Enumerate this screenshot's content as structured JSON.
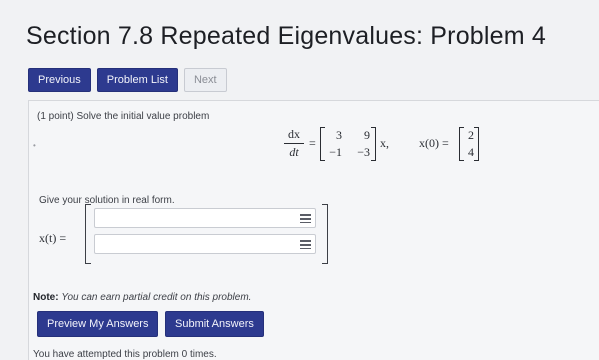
{
  "header": {
    "title": "Section 7.8 Repeated Eigenvalues: Problem 4"
  },
  "nav": {
    "previous": "Previous",
    "problem_list": "Problem List",
    "next": "Next"
  },
  "problem": {
    "intro": "(1 point) Solve the initial value problem",
    "bullet": "•",
    "ode": {
      "numerator": "dx",
      "denominator": "dt",
      "equals": "=",
      "matrix": [
        "3",
        "9",
        "−1",
        "−3"
      ],
      "rhs_tail": "x,",
      "ic_label": "x(0) =",
      "ic_vector": [
        "2",
        "4"
      ]
    },
    "prompt": "Give your solution in real form.",
    "answer_label": "x(t) =",
    "answer_row1": "",
    "answer_row2": ""
  },
  "note": {
    "label": "Note:",
    "text": "You can earn partial credit on this problem."
  },
  "actions": {
    "preview": "Preview My Answers",
    "submit": "Submit Answers"
  },
  "status": {
    "attempts": "You have attempted this problem 0 times."
  },
  "colors": {
    "primary_button": "#2d3a8f",
    "background": "#f1f2f4"
  }
}
